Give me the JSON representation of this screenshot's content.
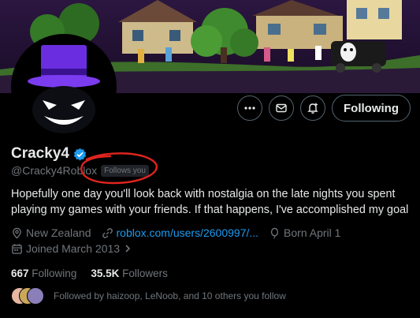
{
  "profile": {
    "display_name": "Cracky4",
    "handle": "@Cracky4Roblox",
    "follows_you": "Follows you",
    "bio": "Hopefully one day you'll look back with nostalgia on the late nights you spent playing my games with your friends. If that happens, I've accomplished my goal",
    "location": "New Zealand",
    "website": "roblox.com/users/2600997/...",
    "birthday": "Born April 1",
    "joined": "Joined March 2013"
  },
  "actions": {
    "more_icon": "more-horizontal-icon",
    "message_icon": "envelope-icon",
    "notify_icon": "bell-plus-icon",
    "following_label": "Following"
  },
  "stats": {
    "following_count": "667",
    "following_label": "Following",
    "followers_count": "35.5K",
    "followers_label": "Followers"
  },
  "followed_by": "Followed by haizoop, LeNoob, and 10 others you follow",
  "colors": {
    "background": "#000000",
    "text_primary": "#e7e9ea",
    "text_secondary": "#71767b",
    "link": "#1d9bf0",
    "verified": "#1d9bf0",
    "annotation": "#e0241f"
  }
}
